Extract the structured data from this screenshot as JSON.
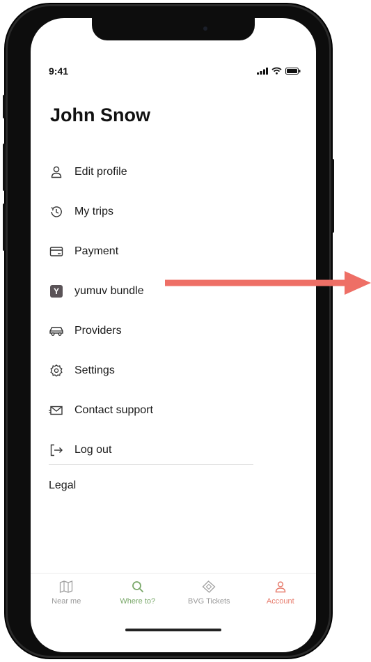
{
  "status_bar": {
    "time": "9:41"
  },
  "profile": {
    "name": "John Snow"
  },
  "menu": {
    "items": [
      {
        "label": "Edit profile",
        "icon": "person-icon"
      },
      {
        "label": "My trips",
        "icon": "history-icon"
      },
      {
        "label": "Payment",
        "icon": "card-icon"
      },
      {
        "label": "yumuv bundle",
        "icon": "yumuv-logo-icon"
      },
      {
        "label": "Providers",
        "icon": "car-icon"
      },
      {
        "label": "Settings",
        "icon": "gear-icon"
      },
      {
        "label": "Contact support",
        "icon": "mail-icon"
      },
      {
        "label": "Log out",
        "icon": "logout-icon"
      }
    ]
  },
  "legal": {
    "label": "Legal"
  },
  "yumuv_badge": {
    "letter": "Y"
  },
  "tabbar": {
    "tabs": [
      {
        "label": "Near me",
        "icon": "map-icon"
      },
      {
        "label": "Where to?",
        "icon": "search-icon"
      },
      {
        "label": "BVG Tickets",
        "icon": "ticket-icon"
      },
      {
        "label": "Account",
        "icon": "person-icon"
      }
    ]
  },
  "colors": {
    "accent_arrow": "#ee6f66",
    "tab_active_account": "#e77d6e",
    "tab_where_to": "#7aa86a",
    "yumuv_badge_bg": "#5a5357"
  }
}
